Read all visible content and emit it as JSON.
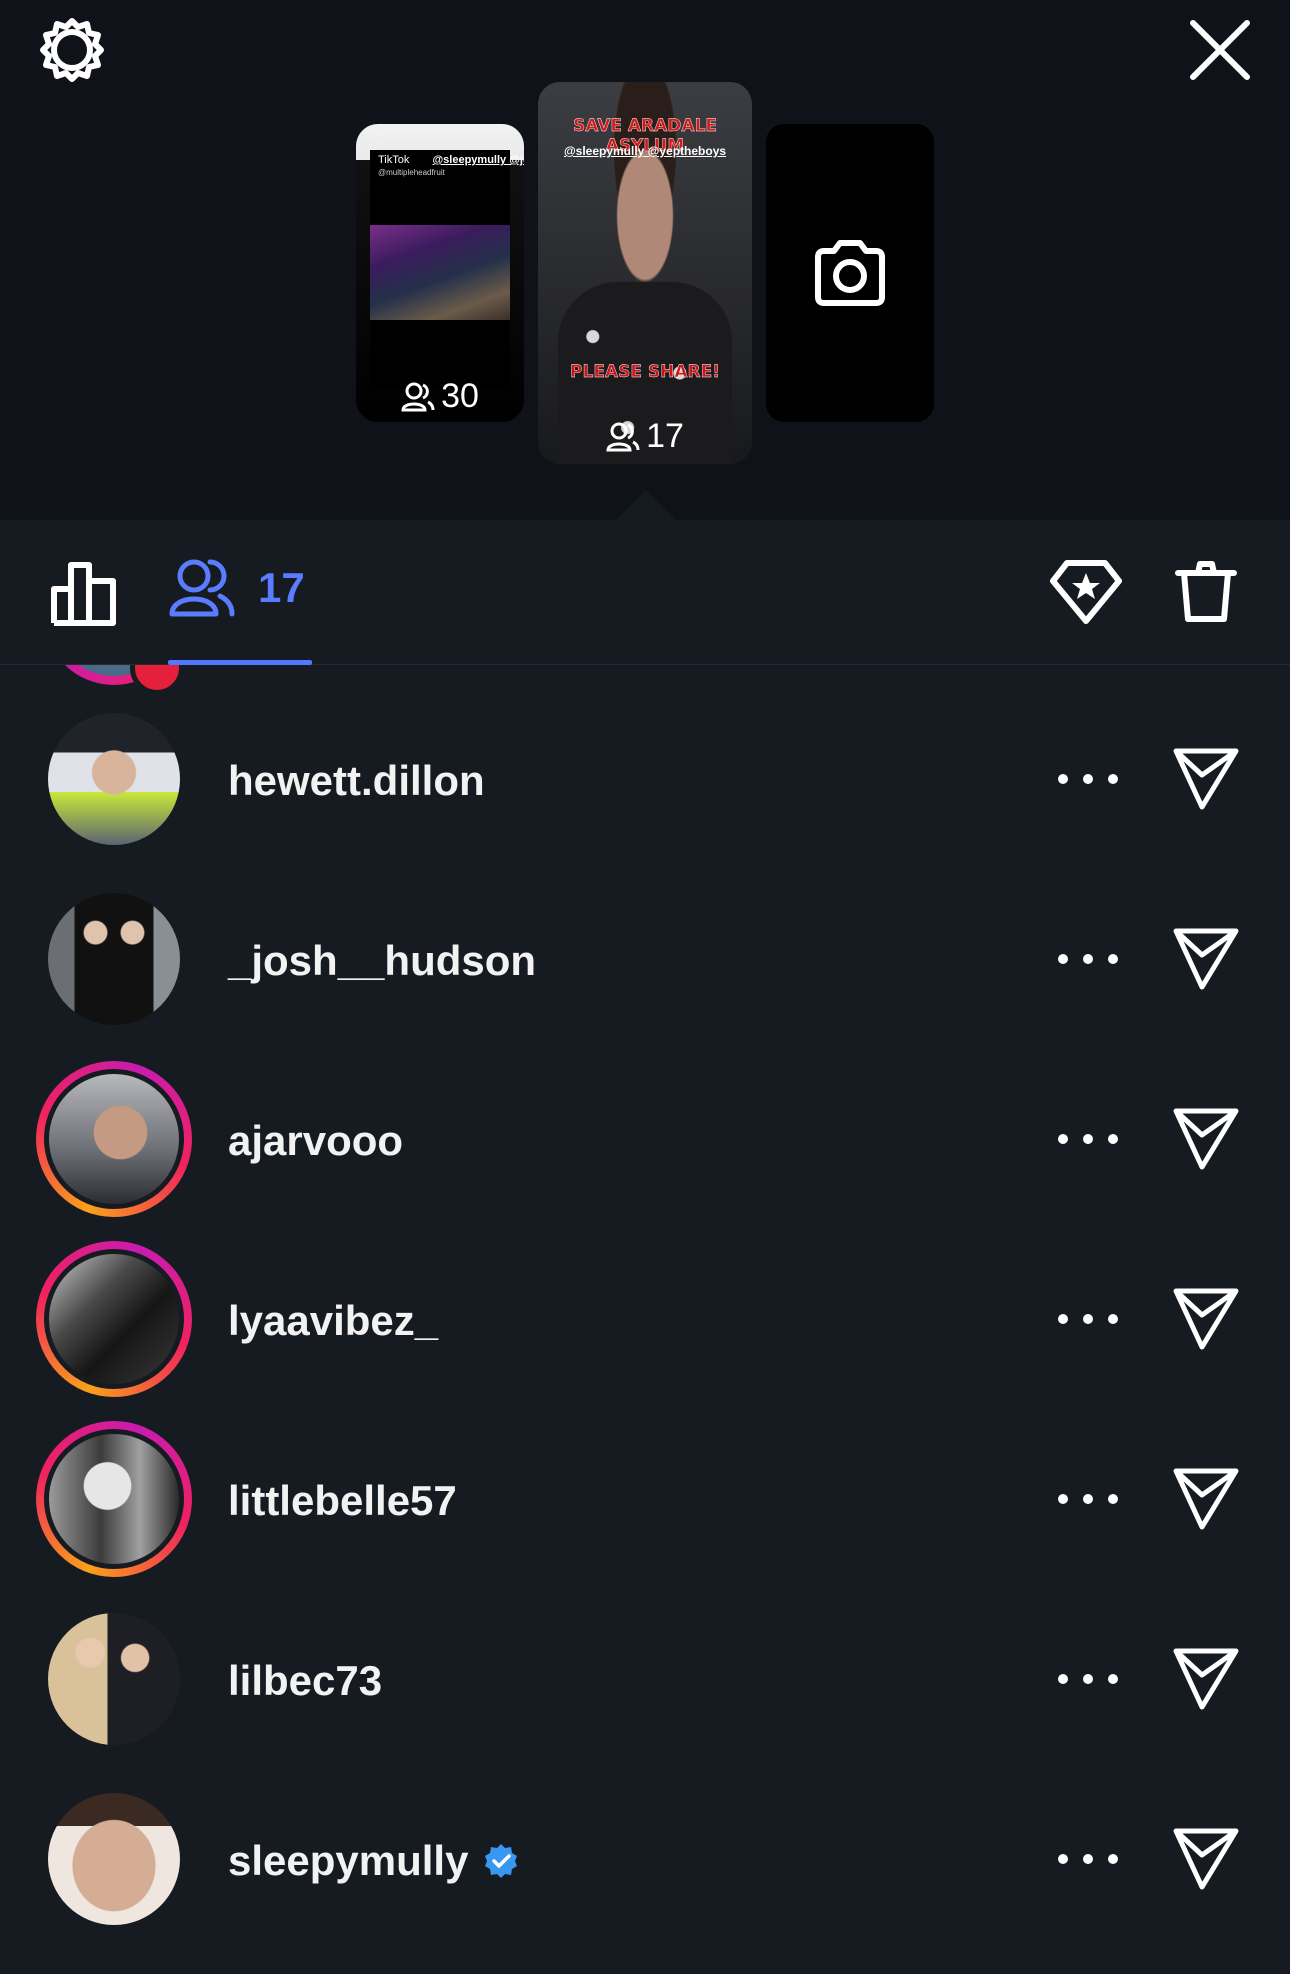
{
  "header": {
    "settings_icon": "gear-icon",
    "close_icon": "close-icon"
  },
  "stories": [
    {
      "type": "tiktok-repost",
      "brand": "TikTok",
      "handles": "@sleepymully @joshdub",
      "sub_handle": "@multipleheadfruit",
      "viewer_count": "30"
    },
    {
      "type": "video",
      "headline": "SAVE ARADALE ASYLUM",
      "handles": "@sleepymully @yeptheboys",
      "footer_text": "PLEASE SHARE!",
      "viewer_count": "17",
      "selected": true
    },
    {
      "type": "add-story",
      "icon": "camera-icon"
    }
  ],
  "tabs": {
    "insights_icon": "bar-chart-icon",
    "viewers_icon": "people-icon",
    "viewers_count": "17",
    "highlight_icon": "highlight-icon",
    "delete_icon": "trash-icon",
    "accent_color": "#5b7cff"
  },
  "viewers": [
    {
      "username": "hewett.dillon",
      "ring": false,
      "verified": false
    },
    {
      "username": "_josh__hudson",
      "ring": false,
      "verified": false
    },
    {
      "username": "ajarvooo",
      "ring": true,
      "verified": false
    },
    {
      "username": "lyaavibez_",
      "ring": true,
      "verified": false
    },
    {
      "username": "littlebelle57",
      "ring": true,
      "verified": false
    },
    {
      "username": "lilbec73",
      "ring": false,
      "verified": false
    },
    {
      "username": "sleepymully",
      "ring": false,
      "verified": true
    }
  ]
}
